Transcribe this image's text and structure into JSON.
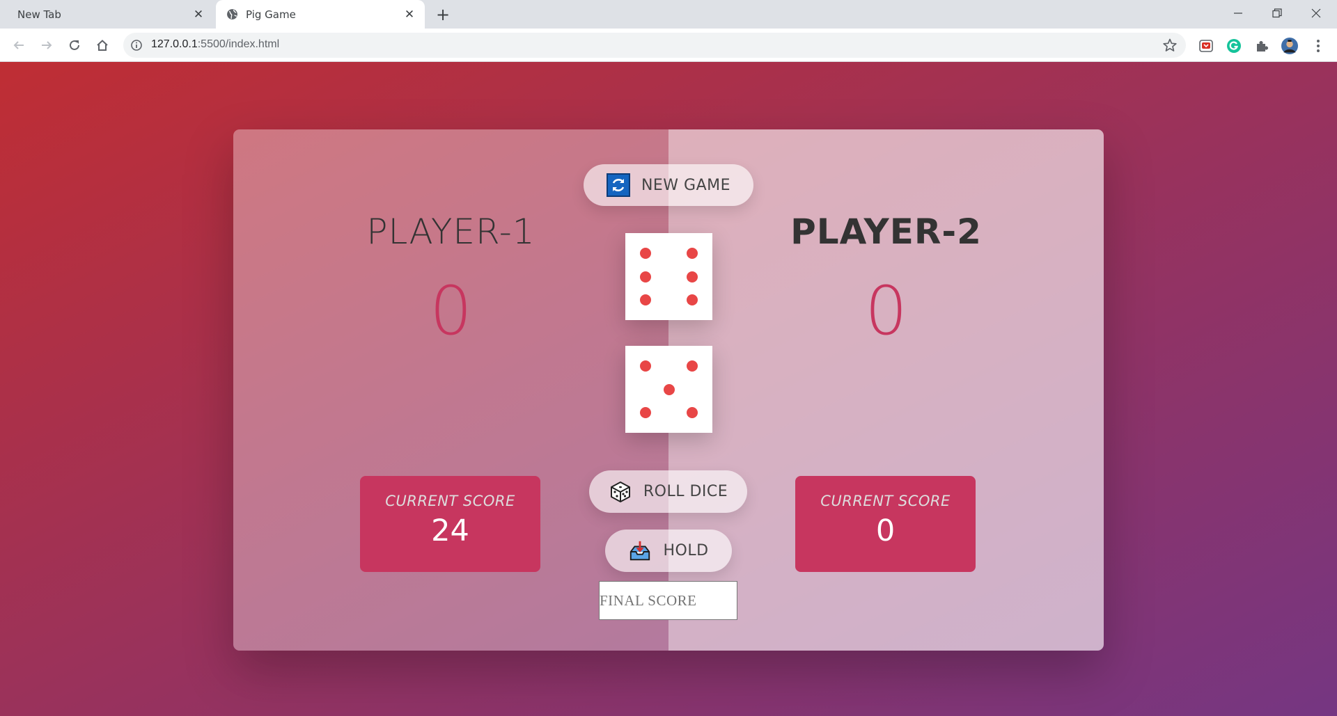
{
  "browser": {
    "tabs": [
      {
        "title": "New Tab",
        "active": false
      },
      {
        "title": "Pig Game",
        "active": true
      }
    ],
    "url_host": "127.0.0.1",
    "url_path": ":5500/index.html"
  },
  "game": {
    "new_game_label": "NEW GAME",
    "roll_dice_label": "ROLL DICE",
    "hold_label": "HOLD",
    "final_score_placeholder": "FINAL SCORE",
    "dice": [
      6,
      5
    ],
    "players": [
      {
        "name": "PLAYER-1",
        "score": "0",
        "current_label": "CURRENT SCORE",
        "current_score": "24",
        "active": false
      },
      {
        "name": "PLAYER-2",
        "score": "0",
        "current_label": "CURRENT SCORE",
        "current_score": "0",
        "active": true
      }
    ]
  },
  "colors": {
    "accent": "#c7365f",
    "pip": "#e84646",
    "gradient_start": "#bf2e34",
    "gradient_end": "#753682"
  },
  "icons": {
    "new_game": "refresh-icon",
    "roll_dice": "dice-icon",
    "hold": "inbox-tray-icon"
  }
}
